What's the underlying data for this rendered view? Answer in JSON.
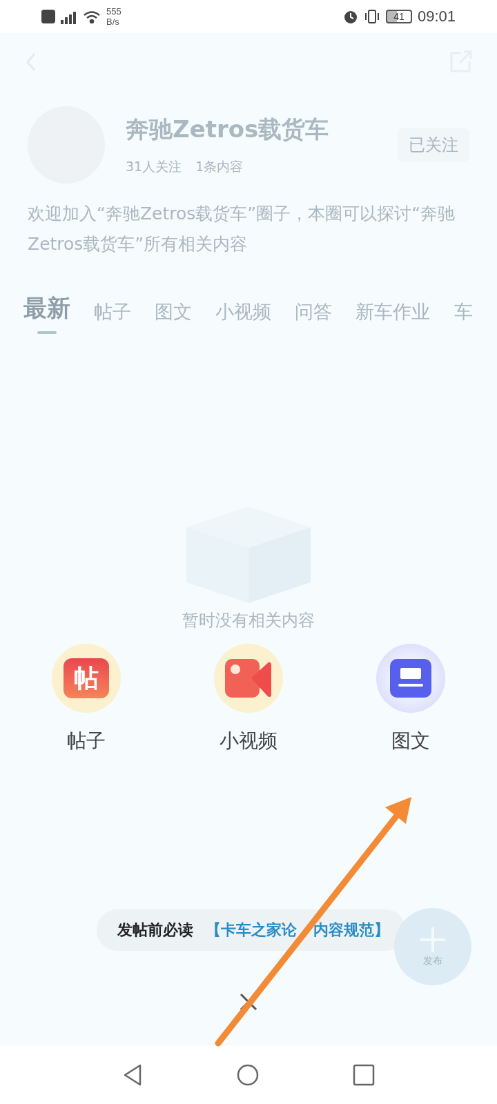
{
  "status_bar": {
    "network_speed": "555",
    "speed_unit": "B/s",
    "battery": "41",
    "time": "09:01"
  },
  "circle": {
    "name": "奔驰Zetros载货车",
    "followers": "31人关注",
    "posts": "1条内容",
    "follow_button": "已关注",
    "description": "欢迎加入“奔驰Zetros载货车”圈子，本圈可以探讨“奔驰Zetros载货车”所有相关内容"
  },
  "tabs": [
    {
      "label": "最新",
      "selected": true
    },
    {
      "label": "帖子",
      "selected": false
    },
    {
      "label": "图文",
      "selected": false
    },
    {
      "label": "小视频",
      "selected": false
    },
    {
      "label": "问答",
      "selected": false
    },
    {
      "label": "新车作业",
      "selected": false
    },
    {
      "label": "车",
      "selected": false
    }
  ],
  "empty_state": "暂时没有相关内容",
  "post_options": [
    {
      "label": "帖子",
      "kind": "post",
      "glyph": "帖"
    },
    {
      "label": "小视频",
      "kind": "video"
    },
    {
      "label": "图文",
      "kind": "article"
    }
  ],
  "notice": {
    "prefix": "发帖前必读",
    "link_parts": [
      "【卡车之家论",
      "内容规范】"
    ]
  },
  "publish_button": {
    "label": "发布"
  }
}
